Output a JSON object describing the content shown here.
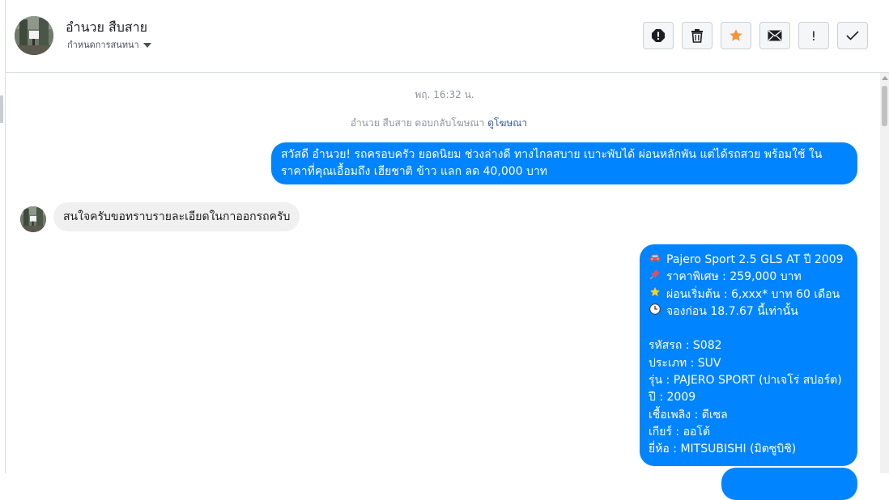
{
  "header": {
    "contact_name": "อำนวย สืบสาย",
    "assign_label": "กำหนดการสนทนา",
    "actions": [
      {
        "icon": "alert-icon",
        "label": ""
      },
      {
        "icon": "trash-icon",
        "label": ""
      },
      {
        "icon": "star-icon",
        "label": ""
      },
      {
        "icon": "mail-icon",
        "label": ""
      },
      {
        "icon": "important-icon",
        "label": "!"
      },
      {
        "icon": "check-icon",
        "label": ""
      }
    ]
  },
  "conversation": {
    "timestamp": "พฤ. 16:32 น.",
    "reply_note": "อำนวย สืบสาย ตอบกลับโฆษณา",
    "view_ad_link": "ดูโฆษณา",
    "message_out_1": "สวัสดี อำนวย! รถครอบครัว ยอดนิยม ช่วงล่างดี ทางไกลสบาย เบาะพับได้ ผ่อนหลักพัน แต่ได้รถสวย พร้อมใช้ ในราคาที่คุณเอื้อมถึง เฮียชาติ ข้าว แลก ลด 40,000 บาท",
    "message_in_1": "สนใจครับขอทราบรายละเอียดในกาออกรถครับ",
    "message_out_2": {
      "line1": "Pajero Sport 2.5 GLS AT ปี 2009",
      "line2": "ราคาพิเศษ : 259,000 บาท",
      "line3": "ผ่อนเริ่มต้น : 6,xxx* บาท 60 เดือน",
      "line4": "จองก่อน 18.7.67 นี้เท่านั้น",
      "line5": "รหัสรถ : S082",
      "line6": "ประเภท : SUV",
      "line7": "รุ่น : PAJERO SPORT (ปาเจโร่ สปอร์ต)",
      "line8": "ปี : 2009",
      "line9": "เชื้อเพลิง : ดีเซล",
      "line10": "เกียร์ : ออโต้",
      "line11": "ยี่ห้อ : MITSUBISHI (มิตซูบิชิ)"
    },
    "icons": {
      "line1": "car-icon",
      "line2": "pushpin-icon",
      "line3": "star-icon",
      "line4": "clock-icon"
    }
  },
  "colors": {
    "outgoing_bubble": "#0084ff",
    "incoming_bubble": "#f1f0f0",
    "star_accent": "#f7923b",
    "link": "#385898",
    "muted_text": "#90949c"
  }
}
